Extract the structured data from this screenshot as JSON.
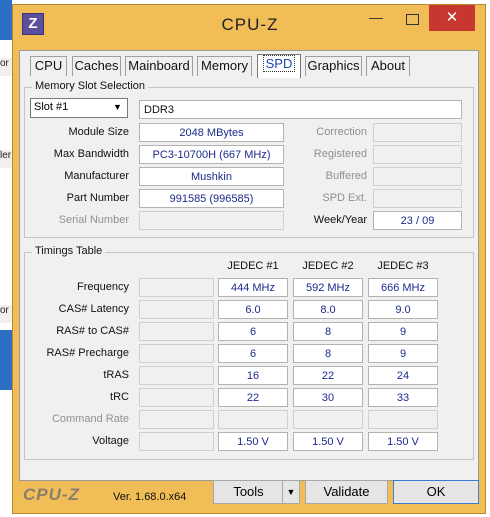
{
  "window": {
    "title": "CPU-Z",
    "app_icon": "Z",
    "minimize": "—",
    "close": "✕"
  },
  "tabs": [
    "CPU",
    "Caches",
    "Mainboard",
    "Memory",
    "SPD",
    "Graphics",
    "About"
  ],
  "active_tab": "SPD",
  "memory_slot": {
    "legend": "Memory Slot Selection",
    "slot": "Slot #1",
    "type": "DDR3",
    "module_size_label": "Module Size",
    "module_size": "2048 MBytes",
    "max_bandwidth_label": "Max Bandwidth",
    "max_bandwidth": "PC3-10700H (667 MHz)",
    "manufacturer_label": "Manufacturer",
    "manufacturer": "Mushkin",
    "part_number_label": "Part Number",
    "part_number": "991585 (996585)",
    "serial_number_label": "Serial Number",
    "serial_number": "",
    "correction_label": "Correction",
    "registered_label": "Registered",
    "buffered_label": "Buffered",
    "spd_ext_label": "SPD Ext.",
    "week_year_label": "Week/Year",
    "week_year": "23 / 09"
  },
  "timings": {
    "legend": "Timings Table",
    "columns": [
      "JEDEC #1",
      "JEDEC #2",
      "JEDEC #3"
    ],
    "rows": [
      {
        "label": "Frequency",
        "values": [
          "444 MHz",
          "592 MHz",
          "666 MHz"
        ],
        "dim": false
      },
      {
        "label": "CAS# Latency",
        "values": [
          "6.0",
          "8.0",
          "9.0"
        ],
        "dim": false
      },
      {
        "label": "RAS# to CAS#",
        "values": [
          "6",
          "8",
          "9"
        ],
        "dim": false
      },
      {
        "label": "RAS# Precharge",
        "values": [
          "6",
          "8",
          "9"
        ],
        "dim": false
      },
      {
        "label": "tRAS",
        "values": [
          "16",
          "22",
          "24"
        ],
        "dim": false
      },
      {
        "label": "tRC",
        "values": [
          "22",
          "30",
          "33"
        ],
        "dim": false
      },
      {
        "label": "Command Rate",
        "values": [
          "",
          "",
          ""
        ],
        "dim": true
      },
      {
        "label": "Voltage",
        "values": [
          "1.50 V",
          "1.50 V",
          "1.50 V"
        ],
        "dim": false
      }
    ]
  },
  "footer": {
    "brand": "CPU-Z",
    "version": "Ver. 1.68.0.x64",
    "tools": "Tools",
    "validate": "Validate",
    "ok": "OK"
  },
  "background": {
    "left_fragments": [
      "or",
      "ler",
      "or"
    ]
  }
}
